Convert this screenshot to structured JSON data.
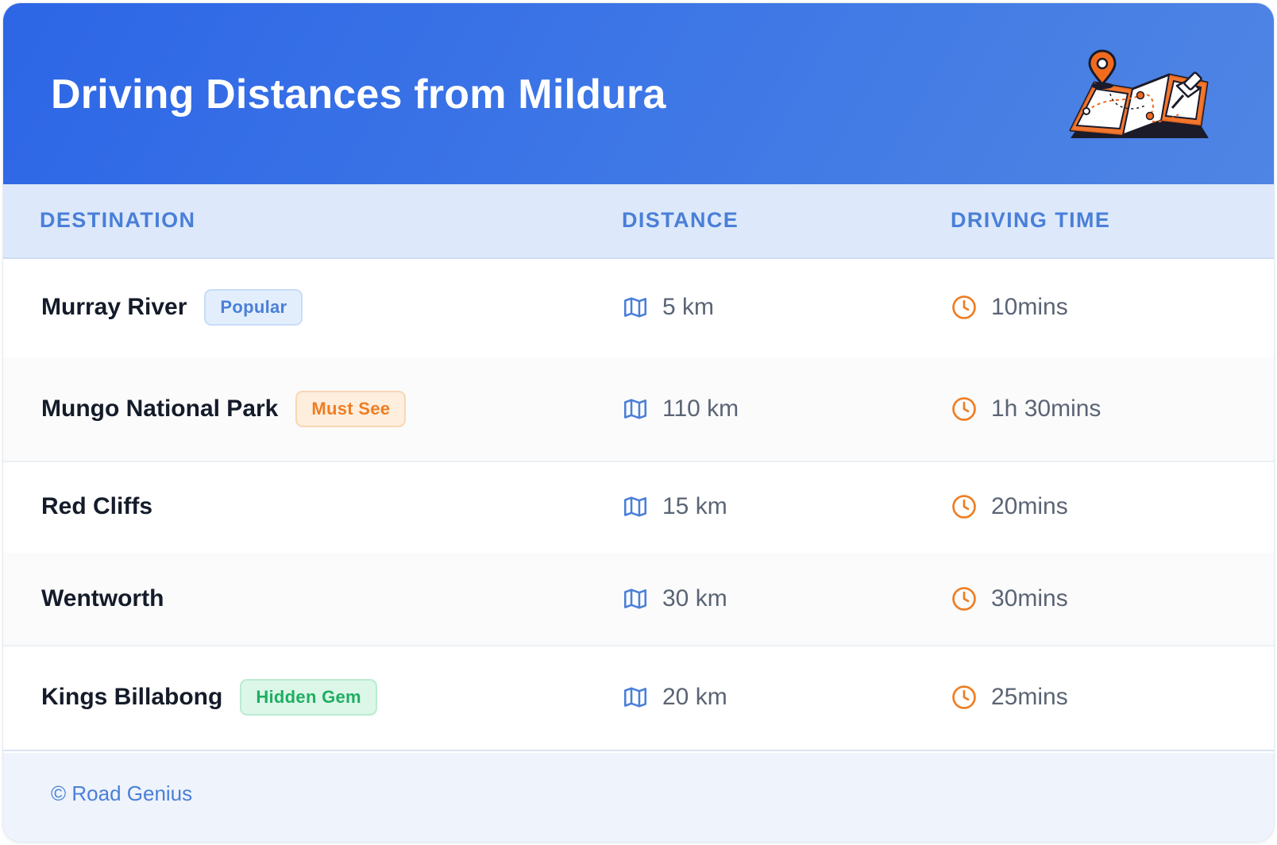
{
  "header": {
    "title": "Driving Distances from Mildura",
    "illustration": "map-with-pins-icon"
  },
  "colors": {
    "header_blue": "#2d66e6",
    "accent_blue": "#4a7fd8",
    "accent_orange": "#ef7d22",
    "accent_green": "#1fae62"
  },
  "table": {
    "columns": [
      "DESTINATION",
      "DISTANCE",
      "DRIVING TIME"
    ],
    "rows": [
      {
        "destination": "Murray River",
        "badge": "Popular",
        "distance": "5 km",
        "time": "10mins"
      },
      {
        "destination": "Mungo National Park",
        "badge": "Must See",
        "distance": "110 km",
        "time": "1h 30mins"
      },
      {
        "destination": "Red Cliffs",
        "distance": "15 km",
        "time": "20mins"
      },
      {
        "destination": "Wentworth",
        "distance": "30 km",
        "time": "30mins"
      },
      {
        "destination": "Kings Billabong",
        "badge": "Hidden Gem",
        "distance": "20 km",
        "time": "25mins"
      }
    ]
  },
  "icons": {
    "distance": "map-icon",
    "time": "clock-icon"
  },
  "footer": {
    "copyright": "© Road Genius"
  }
}
